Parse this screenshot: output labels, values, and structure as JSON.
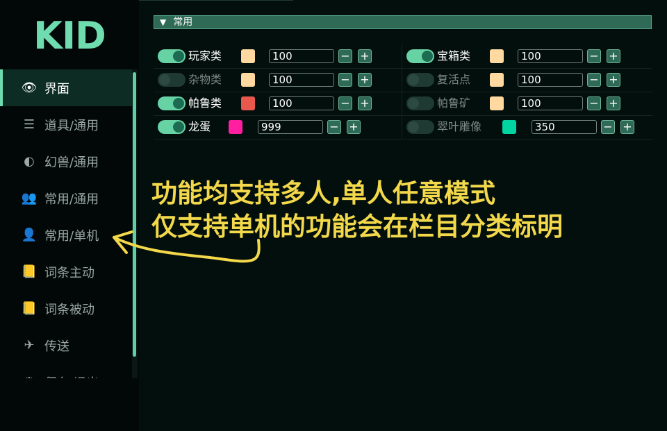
{
  "app": {
    "logo": "KID"
  },
  "sidebar": {
    "items": [
      {
        "label": "界面",
        "icon": "eye-icon",
        "glyph": "👁",
        "active": true
      },
      {
        "label": "道具/通用",
        "icon": "list-icon",
        "glyph": "☰",
        "active": false
      },
      {
        "label": "幻兽/通用",
        "icon": "half-circle-icon",
        "glyph": "◐",
        "active": false
      },
      {
        "label": "常用/通用",
        "icon": "users-icon",
        "glyph": "👥",
        "active": false
      },
      {
        "label": "常用/单机",
        "icon": "user-icon",
        "glyph": "👤",
        "active": false
      },
      {
        "label": "词条主动",
        "icon": "book-icon",
        "glyph": "📒",
        "active": false
      },
      {
        "label": "词条被动",
        "icon": "book-icon",
        "glyph": "📒",
        "active": false
      },
      {
        "label": "传送",
        "icon": "plane-icon",
        "glyph": "✈",
        "active": false
      },
      {
        "label": "保存/退出",
        "icon": "gear-icon",
        "glyph": "⚙",
        "active": false
      }
    ]
  },
  "section": {
    "title": "常用",
    "collapse_glyph": "▼"
  },
  "rows": [
    {
      "left": {
        "enabled": true,
        "label": "玩家类",
        "color": "#ffd9a0",
        "value": "100"
      },
      "right": {
        "enabled": true,
        "label": "宝箱类",
        "color": "#ffd9a0",
        "value": "100"
      }
    },
    {
      "left": {
        "enabled": false,
        "label": "杂物类",
        "color": "#ffd9a0",
        "value": "100"
      },
      "right": {
        "enabled": false,
        "label": "复活点",
        "color": "#ffd9a0",
        "value": "100"
      }
    },
    {
      "left": {
        "enabled": true,
        "label": "帕鲁类",
        "color": "#e8584d",
        "value": "100"
      },
      "right": {
        "enabled": false,
        "label": "帕鲁矿",
        "color": "#ffd9a0",
        "value": "100"
      }
    },
    {
      "left": {
        "enabled": true,
        "label": "龙蛋",
        "color": "#ff1fa0",
        "value": "999"
      },
      "right": {
        "enabled": false,
        "label": "翠叶雕像",
        "color": "#00d4a0",
        "value": "350"
      }
    }
  ],
  "buttons": {
    "minus": "−",
    "plus": "+"
  },
  "annotation": {
    "line1": "功能均支持多人,单人任意模式",
    "line2": "仅支持单机的功能会在栏目分类标明",
    "color": "#f2d84a"
  }
}
